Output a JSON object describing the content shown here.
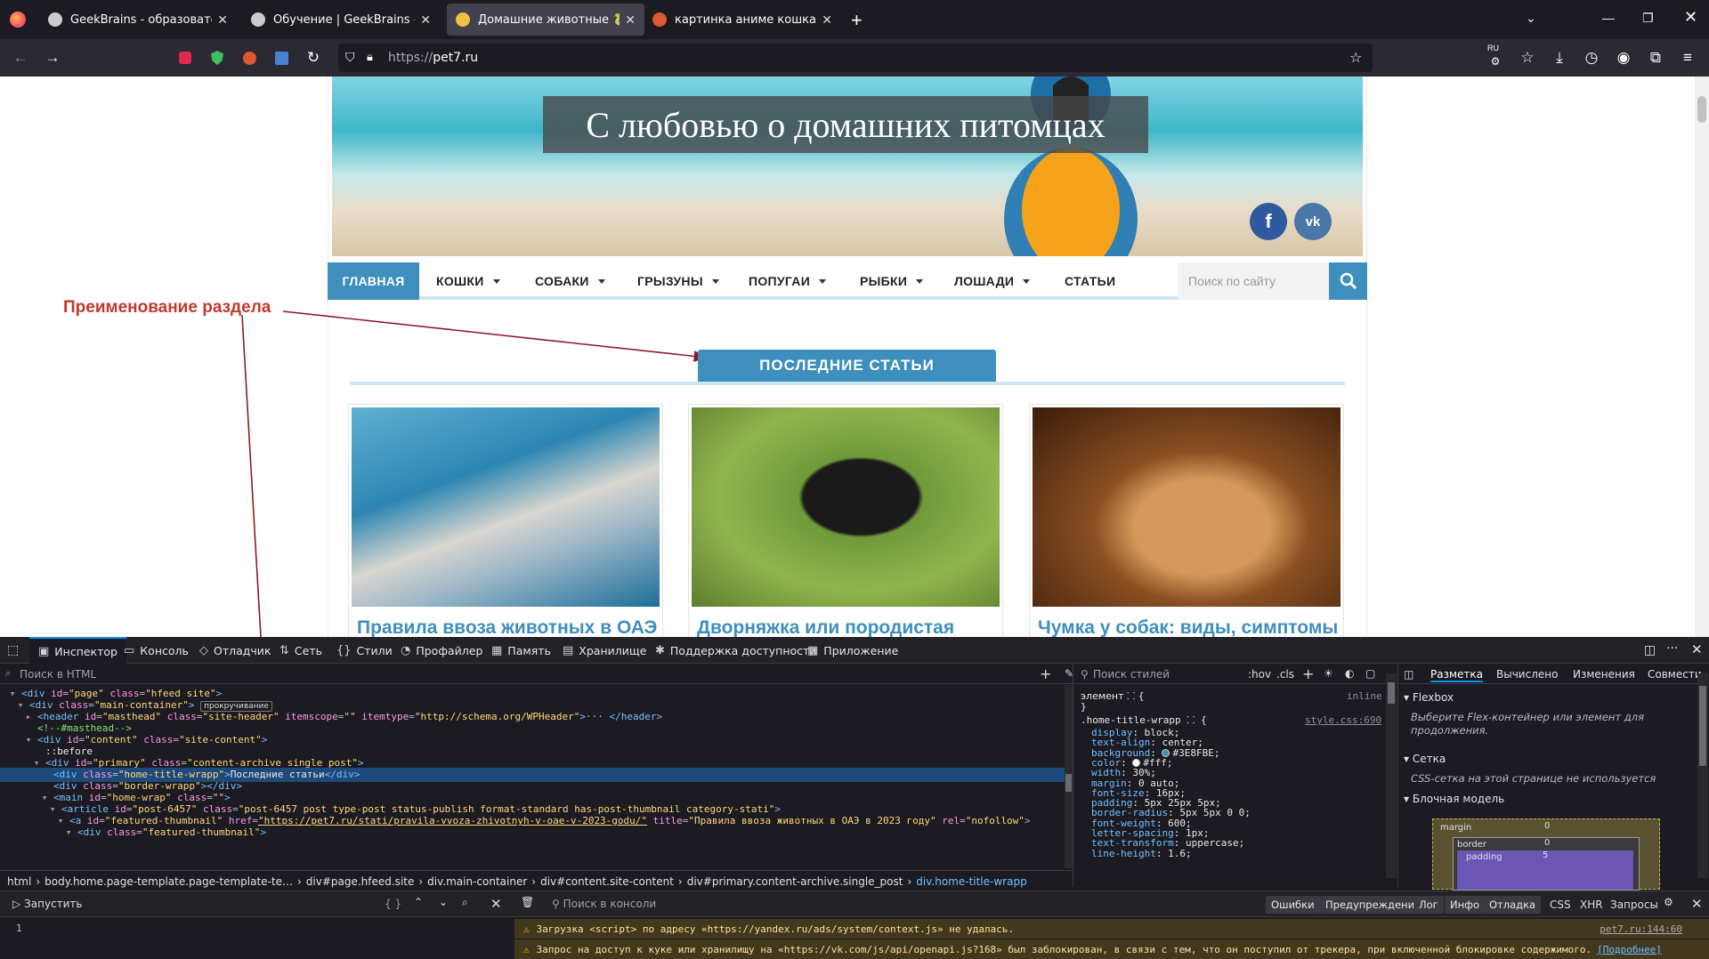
{
  "browser": {
    "tabs": [
      {
        "title": "GeekBrains - образовательный",
        "active": false
      },
      {
        "title": "Обучение | GeekBrains - обра",
        "active": false
      },
      {
        "title": "Домашние животные 🐍 Все",
        "active": true
      },
      {
        "title": "картинка аниме кошка at Duc",
        "active": false
      }
    ],
    "new_tab": "+",
    "url_scheme": "https://",
    "url_host": "pet7.ru",
    "lang_badge": "RU"
  },
  "site": {
    "hero_title": "С любовью о домашних питомцах",
    "social": [
      "f",
      "vk"
    ],
    "menu": [
      {
        "label": "ГЛАВНАЯ",
        "dropdown": false
      },
      {
        "label": "КОШКИ",
        "dropdown": true
      },
      {
        "label": "СОБАКИ",
        "dropdown": true
      },
      {
        "label": "ГРЫЗУНЫ",
        "dropdown": true
      },
      {
        "label": "ПОПУГАИ",
        "dropdown": true
      },
      {
        "label": "РЫБКИ",
        "dropdown": true
      },
      {
        "label": "ЛОШАДИ",
        "dropdown": true
      },
      {
        "label": "СТАТЬИ",
        "dropdown": false
      }
    ],
    "search_placeholder": "Поиск по сайту",
    "annotation": "Преименование раздела",
    "section_title": "ПОСЛЕДНИЕ СТАТЬИ",
    "cards": [
      {
        "title": "Правила ввоза животных в ОАЭ"
      },
      {
        "title": "Дворняжка или породистая"
      },
      {
        "title": "Чумка у собак: виды, симптомы"
      }
    ],
    "accent_color": "#3E8FBE"
  },
  "devtools": {
    "tabs": [
      "Инспектор",
      "Консоль",
      "Отладчик",
      "Сеть",
      "Стили",
      "Профайлер",
      "Память",
      "Хранилище",
      "Поддержка доступности",
      "Приложение"
    ],
    "html_search_placeholder": "Поиск в HTML",
    "scroll_badge": "прокручивание",
    "breadcrumbs": [
      "html",
      "body.home.page-template.page-template-te…",
      "div#page.hfeed.site",
      "div.main-container",
      "div#content.site-content",
      "div#primary.content-archive.single_post",
      "div.home-title-wrapp"
    ],
    "styles_filter_placeholder": "Поиск стилей",
    "styles_hov": ":hov",
    "styles_cls": ".cls",
    "element_rule": "элемент",
    "element_inline": "inline",
    "rule_selector": ".home-title-wrapp",
    "rule_source": "style.css:690",
    "declarations": [
      {
        "name": "display",
        "value": "block;"
      },
      {
        "name": "text-align",
        "value": "center;"
      },
      {
        "name": "background",
        "value": "#3E8FBE;"
      },
      {
        "name": "color",
        "value": "#fff;"
      },
      {
        "name": "width",
        "value": "30%;"
      },
      {
        "name": "margin",
        "value": "0 auto;"
      },
      {
        "name": "font-size",
        "value": "16px;"
      },
      {
        "name": "padding",
        "value": "5px 25px 5px;"
      },
      {
        "name": "border-radius",
        "value": "5px 5px 0 0;"
      },
      {
        "name": "font-weight",
        "value": "600;"
      },
      {
        "name": "letter-spacing",
        "value": "1px;"
      },
      {
        "name": "text-transform",
        "value": "uppercase;"
      },
      {
        "name": "line-height",
        "value": "1.6;"
      }
    ],
    "layout_tabs": [
      "Разметка",
      "Вычислено",
      "Изменения",
      "Совмести"
    ],
    "flexbox_header": "Flexbox",
    "flexbox_hint": "Выберите Flex-контейнер или элемент для продолжения.",
    "grid_header": "Сетка",
    "grid_hint": "CSS-сетка на этой странице не используется",
    "box_header": "Блочная модель",
    "box_labels": {
      "margin": "margin",
      "border": "border",
      "padding": "padding",
      "m_val": "0",
      "b_val": "0",
      "p_val": "5"
    },
    "console": {
      "run_label": "Запустить",
      "filter_placeholder": "Поиск в консоли",
      "filters": [
        "Ошибки",
        "Предупреждения",
        "Лог",
        "Инфо",
        "Отладка"
      ],
      "extra": [
        "CSS",
        "XHR",
        "Запросы"
      ],
      "line_number": "1",
      "messages": [
        {
          "text": "Загрузка <script> по адресу «https://yandex.ru/ads/system/context.js» не удалась.",
          "source": "pet7.ru:144:60"
        },
        {
          "text": "Запрос на доступ к куке или хранилищу на «https://vk.com/js/api/openapi.js?168» был заблокирован, в связи с тем, что он поступил от трекера, при включенной блокировке содержимого.",
          "source": "[Подробнее]"
        }
      ]
    },
    "html_lines": [
      {
        "indent": 2,
        "html": "<span class='tg'>&lt;div</span> <span class='an'>id</span>=<span class='av'>\"page\"</span> <span class='an'>class</span>=<span class='av'>\"hfeed site\"</span><span class='tg'>&gt;</span>"
      },
      {
        "indent": 3,
        "html": "<span class='tg'>&lt;div</span> <span class='an'>class</span>=<span class='av'>\"main-container\"</span><span class='tg'>&gt;</span>"
      },
      {
        "indent": 4,
        "html": "<span class='tg'>&lt;header</span> <span class='an'>id</span>=<span class='av'>\"masthead\"</span> <span class='an'>class</span>=<span class='av'>\"site-header\"</span> <span class='an'>itemscope</span>=<span class='av'>\"\"</span> <span class='an'>itemtype</span>=<span class='av'>\"http://schema.org/WPHeader\"</span><span class='tg'>&gt;</span>··· <span class='tg'>&lt;/header&gt;</span>"
      },
      {
        "indent": 4,
        "html": "<span class='cm'>&lt;!--#masthead--&gt;</span>"
      },
      {
        "indent": 4,
        "html": "<span class='tg'>&lt;div</span> <span class='an'>id</span>=<span class='av'>\"content\"</span> <span class='an'>class</span>=<span class='av'>\"site-content\"</span><span class='tg'>&gt;</span>"
      },
      {
        "indent": 5,
        "html": "<span class='tx'>::before</span>"
      },
      {
        "indent": 5,
        "html": "<span class='tg'>&lt;div</span> <span class='an'>id</span>=<span class='av'>\"primary\"</span> <span class='an'>class</span>=<span class='av'>\"content-archive single_post\"</span><span class='tg'>&gt;</span>"
      },
      {
        "indent": 6,
        "html": "<span class='tg'>&lt;div</span> <span class='an'>class</span>=<span class='av'>\"home-title-wrapp\"</span><span class='tg'>&gt;</span><span class='tx'>Последние статьи</span><span class='tg'>&lt;/div&gt;</span>"
      },
      {
        "indent": 6,
        "html": "<span class='tg'>&lt;div</span> <span class='an'>class</span>=<span class='av'>\"border-wrapp\"</span><span class='tg'>&gt;&lt;/div&gt;</span>"
      },
      {
        "indent": 6,
        "html": "<span class='tg'>&lt;main</span> <span class='an'>id</span>=<span class='av'>\"home-wrap\"</span> <span class='an'>class</span>=<span class='av'>\"\"</span><span class='tg'>&gt;</span>"
      },
      {
        "indent": 7,
        "html": "<span class='tg'>&lt;article</span> <span class='an'>id</span>=<span class='av'>\"post-6457\"</span> <span class='an'>class</span>=<span class='av'>\"post-6457 post type-post status-publish format-standard has-post-thumbnail category-stati\"</span><span class='tg'>&gt;</span>"
      },
      {
        "indent": 8,
        "html": "<span class='tg'>&lt;a</span> <span class='an'>id</span>=<span class='av'>\"featured-thumbnail\"</span> <span class='an'>href</span>=<span class='av'><u>\"https://pet7.ru/stati/pravila-vvoza-zhivotnyh-v-oae-v-2023-godu/\"</u></span> <span class='an'>title</span>=<span class='av'>\"Правила ввоза животных в ОАЭ в 2023 году\"</span> <span class='an'>rel</span>=<span class='av'>\"nofollow\"</span><span class='tg'>&gt;</span>"
      },
      {
        "indent": 9,
        "html": "<span class='tg'>&lt;div</span> <span class='an'>class</span>=<span class='av'>\"featured-thumbnail\"</span><span class='tg'>&gt;</span>"
      }
    ]
  }
}
